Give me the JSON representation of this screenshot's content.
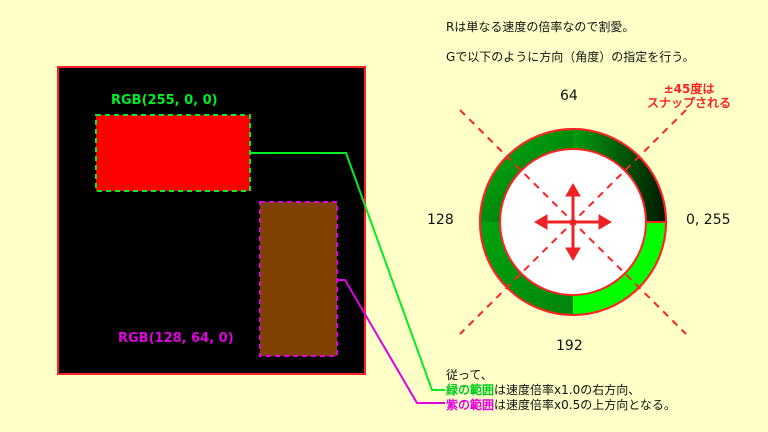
{
  "notes": {
    "top_line1": "Rは単なる速度の倍率なので割愛。",
    "top_line2": "Gで以下のように方向（角度）の指定を行う。",
    "bottom_intro": "従って、",
    "green_range": "緑の範囲",
    "green_rest": "は速度倍率x1.0の右方向、",
    "purple_range": "紫の範囲",
    "purple_rest": "は速度倍率x0.5の上方向となる。"
  },
  "canvas": {
    "red_rect_label": "RGB(255, 0, 0)",
    "brown_rect_label": "RGB(128, 64, 0)"
  },
  "ring": {
    "label_top": "64",
    "label_left": "128",
    "label_bottom": "192",
    "label_right": "0, 255",
    "snap_note": "±45度は\nスナップされる"
  },
  "colors": {
    "background": "#ffffc8",
    "canvas_bg": "#000000",
    "frame_red": "#ff2222",
    "red_rect": "#ff0000",
    "brown_rect": "#804000",
    "green_label": "#00ee22",
    "purple_label": "#e000e0",
    "ring_bright_green": "#00ff00",
    "ring_dark_green": "#008000"
  },
  "icons": {
    "center": "four-way-arrow-icon"
  }
}
